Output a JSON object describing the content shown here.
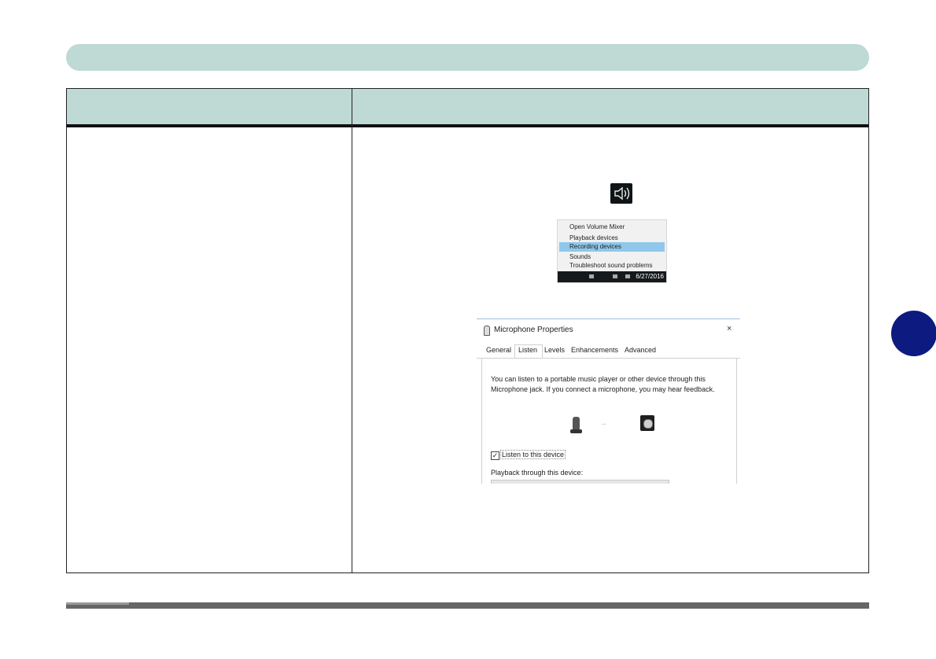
{
  "context_menu": {
    "items": [
      "Open Volume Mixer",
      "Playback devices",
      "Recording devices",
      "Sounds",
      "Troubleshoot sound problems"
    ],
    "highlighted_item": "Recording devices",
    "taskbar_date": "6/27/2016"
  },
  "dialog": {
    "title": "Microphone Properties",
    "close_glyph": "×",
    "tabs": [
      "General",
      "Listen",
      "Levels",
      "Enhancements",
      "Advanced"
    ],
    "active_tab": "Listen",
    "description_line1": "You can listen to a portable music player or other device through this",
    "description_line2": "Microphone jack. If you connect a microphone, you may hear feedback.",
    "listen_checkbox_label": "Listen to this device",
    "listen_checked": true,
    "checkbox_glyph": "✓",
    "playback_label": "Playback through this device:",
    "arrow_glyph": "→"
  },
  "icons": {
    "volume": "speaker-volume-icon",
    "microphone": "microphone-icon",
    "speaker": "speaker-device-icon"
  },
  "colors": {
    "header_bar": "#bfd9d5",
    "chapter_tab": "#0d1a80",
    "menu_highlight": "#8fc8ea"
  }
}
